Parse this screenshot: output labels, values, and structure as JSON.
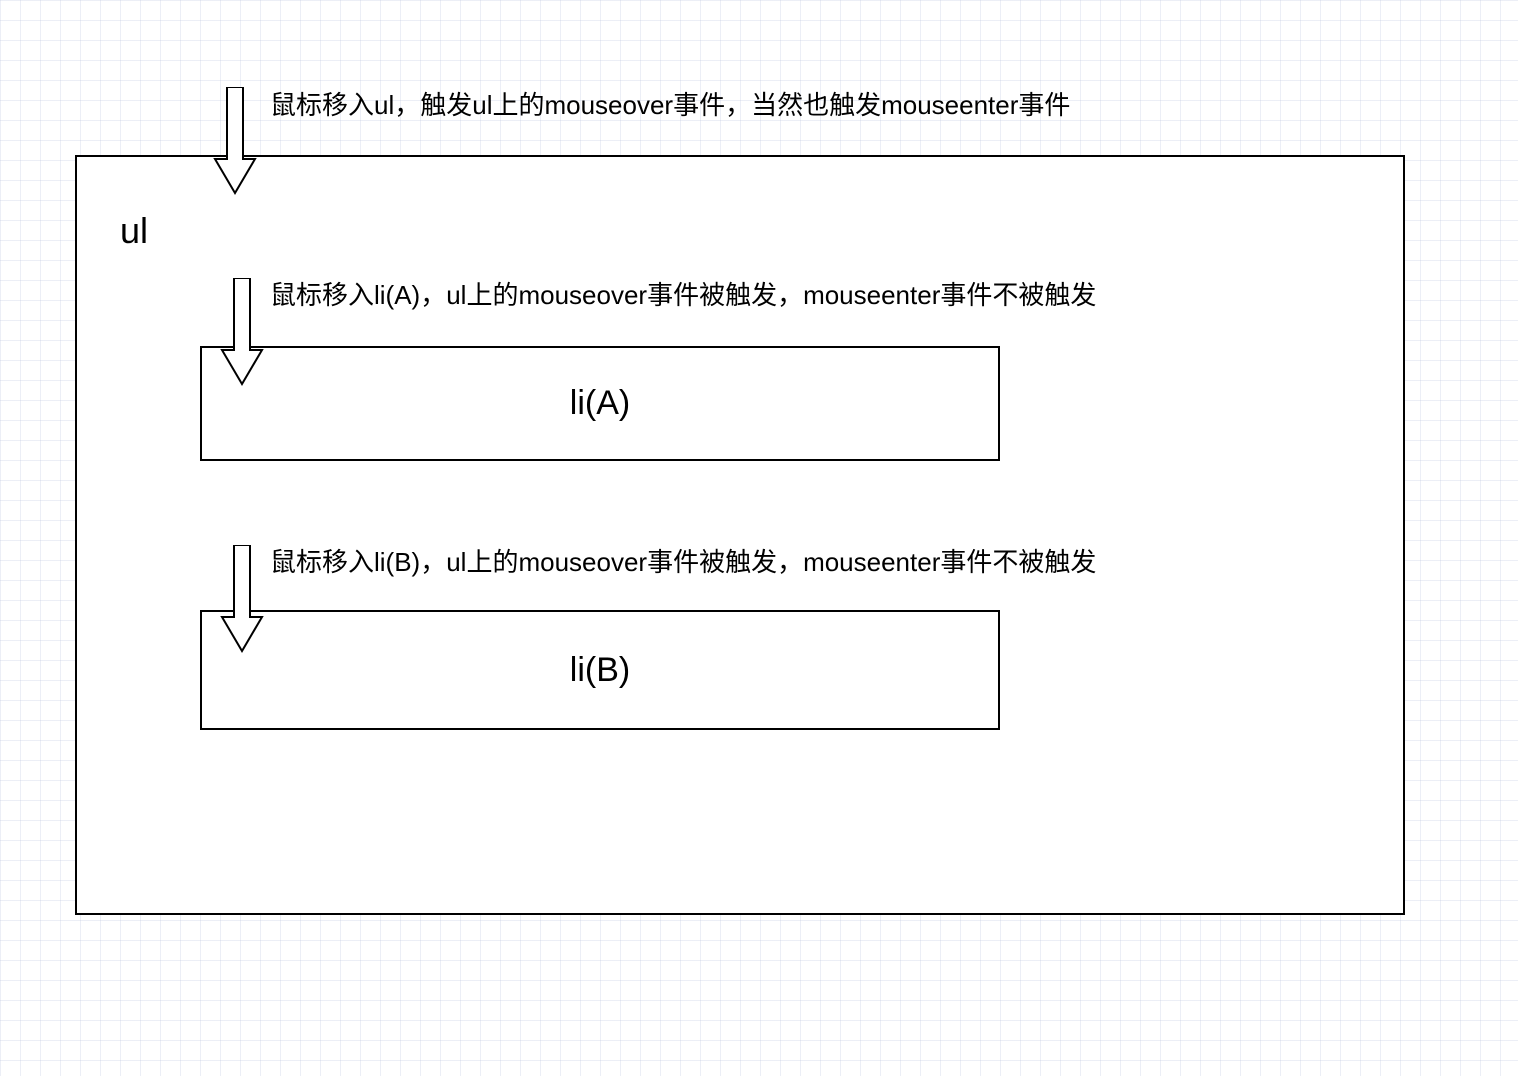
{
  "container": {
    "label": "ul"
  },
  "items": {
    "a_label": "li(A)",
    "b_label": "li(B)"
  },
  "annotations": {
    "enter_ul": "鼠标移入ul，触发ul上的mouseover事件，当然也触发mouseenter事件",
    "enter_li_a": "鼠标移入li(A)，ul上的mouseover事件被触发，mouseenter事件不被触发",
    "enter_li_b": "鼠标移入li(B)，ul上的mouseover事件被触发，mouseenter事件不被触发"
  }
}
